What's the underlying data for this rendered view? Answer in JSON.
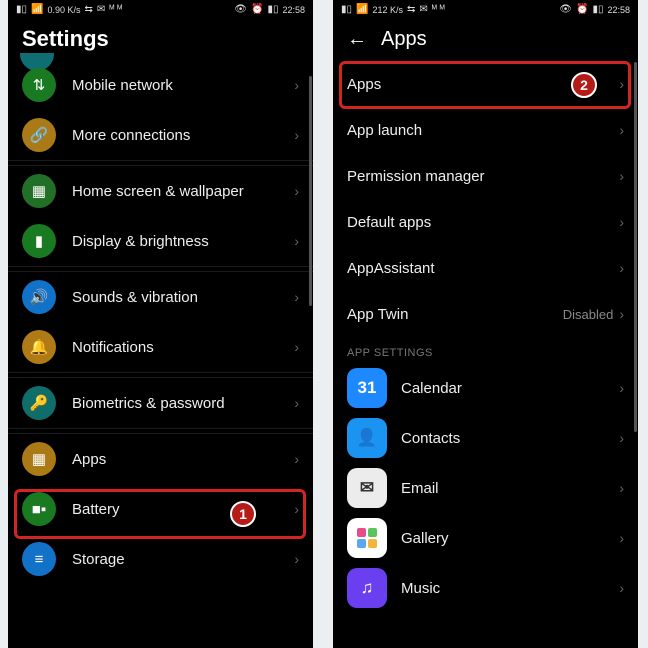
{
  "status": {
    "net": "0.90 K/s",
    "time": "22:58",
    "net2": "212 K/s"
  },
  "left": {
    "title": "Settings",
    "rows": [
      {
        "label": "Mobile network",
        "icon": "mobile-network-icon",
        "color": "c-green",
        "glyph": "⇅"
      },
      {
        "label": "More connections",
        "icon": "more-connections-icon",
        "color": "c-brown",
        "glyph": "🔗"
      },
      {
        "label": "Home screen & wallpaper",
        "icon": "home-wallpaper-icon",
        "color": "c-dgreen",
        "glyph": "▦"
      },
      {
        "label": "Display & brightness",
        "icon": "display-brightness-icon",
        "color": "c-green",
        "glyph": "▮"
      },
      {
        "label": "Sounds & vibration",
        "icon": "sounds-vibration-icon",
        "color": "c-blue",
        "glyph": "🔊"
      },
      {
        "label": "Notifications",
        "icon": "notifications-icon",
        "color": "c-orange",
        "glyph": "🔔"
      },
      {
        "label": "Biometrics & password",
        "icon": "biometrics-icon",
        "color": "c-key",
        "glyph": "🔑"
      },
      {
        "label": "Apps",
        "icon": "apps-icon",
        "color": "c-brown",
        "glyph": "▦"
      },
      {
        "label": "Battery",
        "icon": "battery-icon",
        "color": "c-green",
        "glyph": "■▪"
      },
      {
        "label": "Storage",
        "icon": "storage-icon",
        "color": "c-blue",
        "glyph": "≡"
      }
    ],
    "badge": "1"
  },
  "right": {
    "title": "Apps",
    "rows": [
      {
        "label": "Apps"
      },
      {
        "label": "App launch"
      },
      {
        "label": "Permission manager"
      },
      {
        "label": "Default apps"
      },
      {
        "label": "AppAssistant"
      },
      {
        "label": "App Twin",
        "value": "Disabled"
      }
    ],
    "section": "APP SETTINGS",
    "apps": [
      {
        "label": "Calendar",
        "icon": "calendar-app-icon",
        "color": "c-cal",
        "glyph": "31"
      },
      {
        "label": "Contacts",
        "icon": "contacts-app-icon",
        "color": "c-con",
        "glyph": "👤"
      },
      {
        "label": "Email",
        "icon": "email-app-icon",
        "color": "c-mail",
        "glyph": "✉"
      },
      {
        "label": "Gallery",
        "icon": "gallery-app-icon",
        "color": "c-gal",
        "glyph": ""
      },
      {
        "label": "Music",
        "icon": "music-app-icon",
        "color": "c-mus",
        "glyph": "♫"
      }
    ],
    "badge": "2"
  }
}
